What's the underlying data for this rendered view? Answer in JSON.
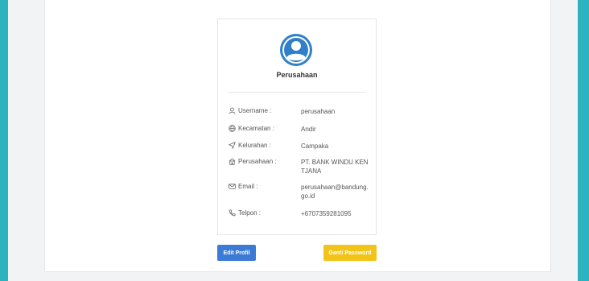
{
  "profile": {
    "role": "Perusahaan",
    "fields": [
      {
        "icon": "user-icon",
        "label": "Username :",
        "value": "perusahaan"
      },
      {
        "icon": "globe-icon",
        "label": "Kecamatan :",
        "value": "Andir"
      },
      {
        "icon": "send-icon",
        "label": "Kelurahan :",
        "value": "Campaka"
      },
      {
        "icon": "building-icon",
        "label": "Perusahaan :",
        "value": "PT. BANK WINDU KENTJANA"
      },
      {
        "icon": "mail-icon",
        "label": "Email :",
        "value": "perusahaan@bandung.go.id"
      },
      {
        "icon": "phone-icon",
        "label": "Telpon :",
        "value": "+6707359281095"
      }
    ]
  },
  "buttons": {
    "edit_label": "Edit Profil",
    "password_label": "Ganti Password"
  },
  "colors": {
    "background": "#2bb3c0",
    "avatar": "#2f7fc9",
    "edit_button": "#3b7bd6",
    "password_button": "#f2c418"
  }
}
